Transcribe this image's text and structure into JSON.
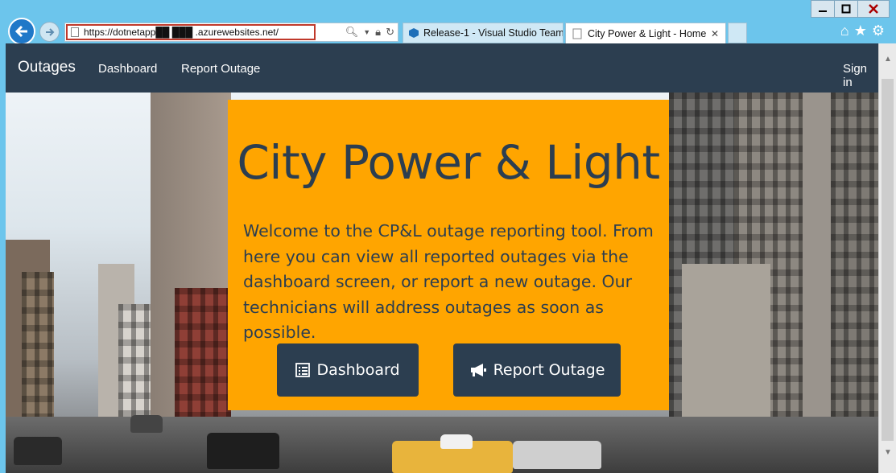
{
  "browser": {
    "url": "https://dotnetapp██  ███ .azurewebsites.net/",
    "tabs": [
      {
        "label": "Release-1 - Visual Studio Team...",
        "icon": "vsts-icon",
        "active": false
      },
      {
        "label": "City Power & Light - Home",
        "icon": "page-icon",
        "active": true
      }
    ],
    "window_controls": [
      "minimize",
      "maximize",
      "close"
    ],
    "toolbar_icons": [
      "home-icon",
      "star-icon",
      "gear-icon"
    ]
  },
  "navbar": {
    "brand": "Outages",
    "links": [
      "Dashboard",
      "Report Outage"
    ],
    "sign_in": "Sign in"
  },
  "hero": {
    "title": "City Power & Light",
    "text": "Welcome to the CP&L outage reporting tool. From here you can view all reported outages via the dashboard screen, or report a new outage. Our technicians will address outages as soon as possible.",
    "buttons": {
      "dashboard": "Dashboard",
      "report": "Report Outage"
    }
  },
  "colors": {
    "navbar": "#2c3e50",
    "hero_bg": "#ffa500",
    "hero_text": "#2c3e50",
    "button_bg": "#2c3e50"
  }
}
